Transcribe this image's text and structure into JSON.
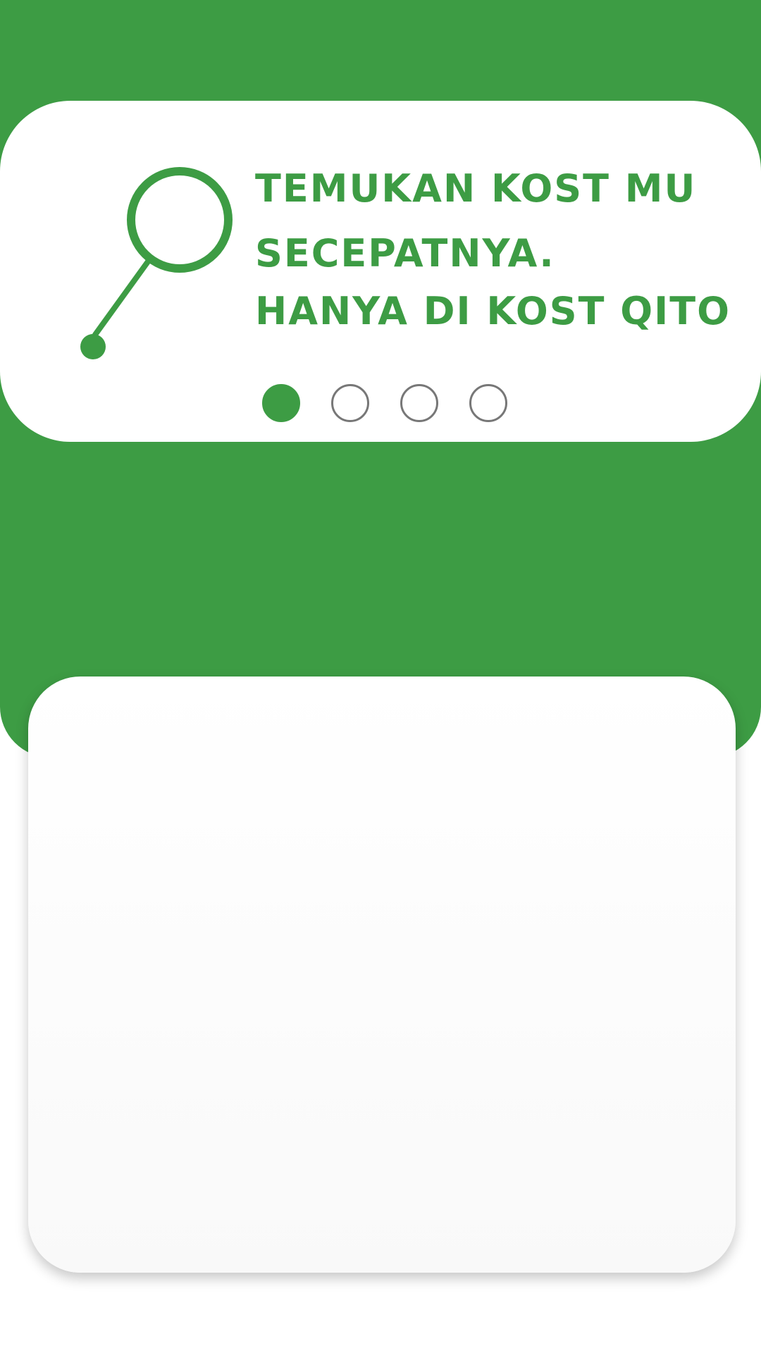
{
  "onboarding": {
    "headline_line1": "TEMUKAN KOST MU",
    "headline_line2": "SECEPATNYA.",
    "headline_line3": "HANYA DI KOST QITO",
    "icon": "search-icon",
    "pager": {
      "total_pages": 4,
      "current_page": 1
    }
  },
  "colors": {
    "brand_green": "#3d9c44",
    "card_white": "#ffffff",
    "inactive_dot_border": "#777777"
  }
}
